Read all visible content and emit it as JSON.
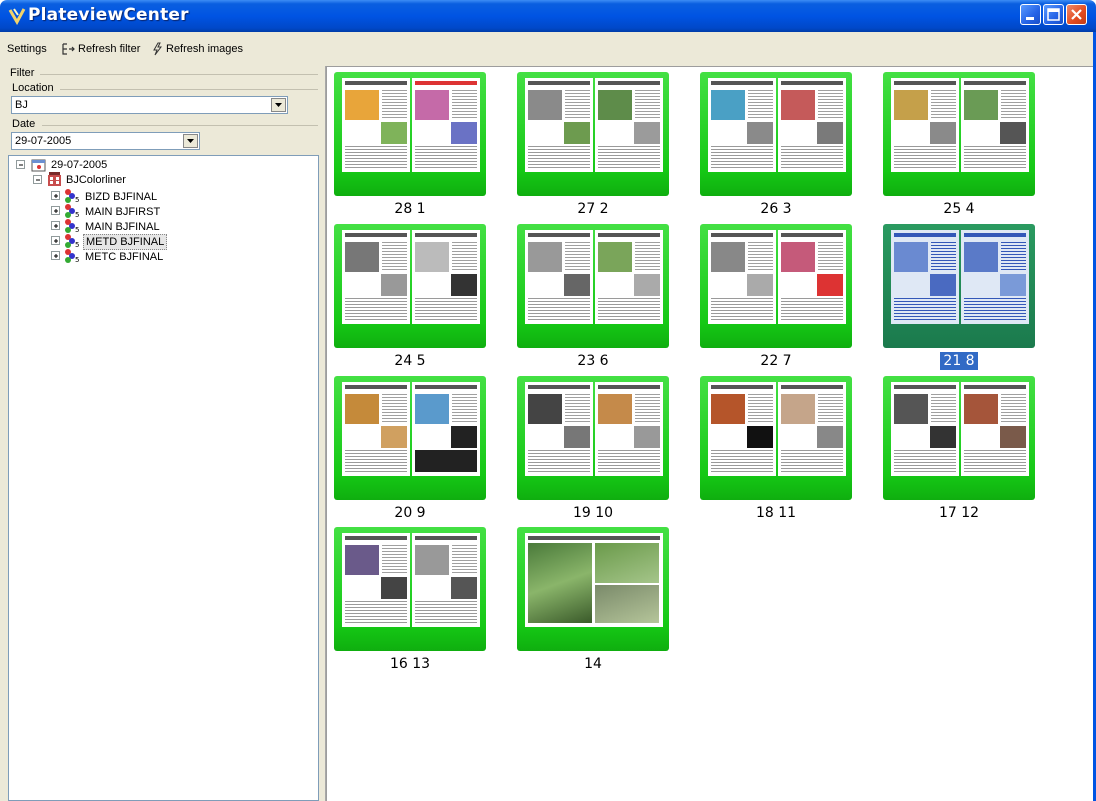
{
  "window": {
    "title": "PlateviewCenter",
    "buttons": [
      "minimize-button",
      "maximize-button",
      "close-button"
    ]
  },
  "colors": {
    "titlebar": "#0054e3",
    "plate_ok": "#15c815",
    "plate_selected": "#1b7a4d",
    "selection": "#316ac5"
  },
  "toolbar": {
    "settings_label": "Settings",
    "refresh_filter_label": "Refresh filter",
    "refresh_images_label": "Refresh images"
  },
  "filter": {
    "group_label": "Filter",
    "location_label": "Location",
    "location_value": "BJ",
    "date_label": "Date",
    "date_value": "29-07-2005"
  },
  "tree": {
    "root": "29-07-2005",
    "press": "BJColorliner",
    "editions": [
      {
        "label": "BIZD BJFINAL"
      },
      {
        "label": "MAIN BJFIRST"
      },
      {
        "label": "MAIN BJFINAL"
      },
      {
        "label": "METD BJFINAL",
        "selected": true
      },
      {
        "label": "METC BJFINAL"
      }
    ]
  },
  "plates": [
    {
      "label": "28 1",
      "selected": false
    },
    {
      "label": "27 2",
      "selected": false
    },
    {
      "label": "26 3",
      "selected": false
    },
    {
      "label": "25 4",
      "selected": false
    },
    {
      "label": "24 5",
      "selected": false
    },
    {
      "label": "23 6",
      "selected": false
    },
    {
      "label": "22 7",
      "selected": false
    },
    {
      "label": "21 8",
      "selected": true
    },
    {
      "label": "20 9",
      "selected": false
    },
    {
      "label": "19 10",
      "selected": false
    },
    {
      "label": "18 11",
      "selected": false
    },
    {
      "label": "17 12",
      "selected": false
    },
    {
      "label": "16 13",
      "selected": false
    },
    {
      "label": "14",
      "selected": false,
      "single": true
    }
  ]
}
